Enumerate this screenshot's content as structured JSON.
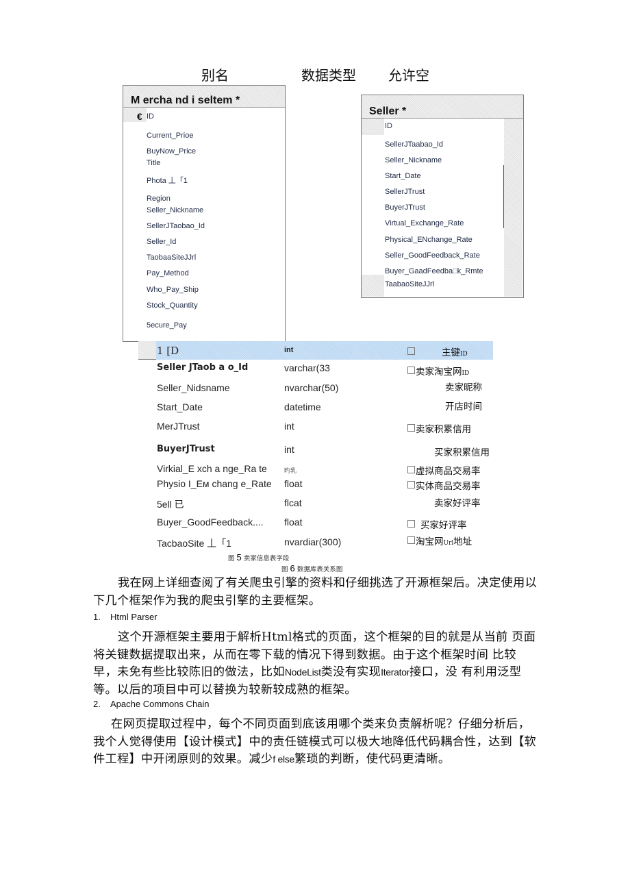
{
  "column_headers": {
    "alias": "别名",
    "data_type": "数据类型",
    "nullable": "允许空"
  },
  "merchandise_entity": {
    "title": "M ercha nd i seltem *",
    "key_icon": "key-icon",
    "key_glyph": "€",
    "fields": [
      "ID",
      "Current_Prioe",
      "BuyNow_Price",
      "Title",
      "Phota 丄「1",
      "Region",
      "Seller_Nickname",
      "SellerJTaobao_Id",
      "Seller_Id",
      "TaobaaSiteJJrl",
      "Pay_Method",
      "Who_Pay_Ship",
      "Stock_Quantity",
      "5ecure_Pay"
    ]
  },
  "seller_entity": {
    "title": "Seller *",
    "fields": [
      "ID",
      "SellerJTaabao_Id",
      "Seller_Nickname",
      "Start_Date",
      "SellerJTrust",
      "BuyerJTrust",
      "Virtual_Exchange_Rate",
      "Physical_ENchange_Rate",
      "Seller_GoodFeedback_Rate",
      "Buyer_GaadFeedba□k_Rmte",
      "TaabaoSiteJJrl"
    ]
  },
  "seller_table": {
    "rows": [
      {
        "alias": "1 [D",
        "type": "int",
        "checkbox": true,
        "desc": "主键",
        "desc_suffix": "ID",
        "selected": true
      },
      {
        "alias": "Seller JTaob a o_Id",
        "type": "varchar(33",
        "checkbox": true,
        "desc": "卖家淘宝网",
        "desc_suffix": "ID",
        "bold": true
      },
      {
        "alias": "Seller_Nidsname",
        "type": "nvarchar(50)",
        "checkbox": false,
        "desc": "卖家昵称",
        "desc_suffix": ""
      },
      {
        "alias": "Start_Date",
        "type": "datetime",
        "checkbox": false,
        "desc": "开店时间",
        "desc_suffix": ""
      },
      {
        "alias": "MerJTrust",
        "type": "int",
        "checkbox": true,
        "desc": "卖家积累信用",
        "desc_suffix": ""
      },
      {
        "alias": "BuyerJTrust",
        "type": "int",
        "checkbox": false,
        "desc": "买家积累信用",
        "desc_suffix": "",
        "bold": true
      },
      {
        "alias": "Virkial_E xch a nge_Ra te",
        "type": "旳乳",
        "checkbox": true,
        "desc": "虚拟商品交易率",
        "desc_suffix": ""
      },
      {
        "alias": "Physio I_Eм chang e_Rate",
        "type": "float",
        "checkbox": true,
        "desc": "实体商品交易率",
        "desc_suffix": ""
      },
      {
        "alias": "5ell 已",
        "type": "flcat",
        "checkbox": false,
        "desc": "卖家好评率",
        "desc_suffix": ""
      },
      {
        "alias": "Buyer_GoodFeedback....",
        "type": "float",
        "checkbox": true,
        "desc": "买家好评率",
        "desc_suffix": ""
      },
      {
        "alias": "TacbaoSite 丄「1",
        "type": "nvardiar(300)",
        "checkbox": true,
        "desc": "淘宝网",
        "desc_suffix": "Url",
        "desc_tail": "地址"
      }
    ]
  },
  "captions": {
    "fig5_prefix": "图",
    "fig5_num": "5",
    "fig5_text": "卖家信息表字段",
    "fig6_prefix": "图",
    "fig6_num": "6",
    "fig6_text": "数据库表关系图"
  },
  "body": {
    "para1": "我在网上详细查阅了有关爬虫引擎的资料和仔细挑选了开源框架后。决定使用以下几个框架作为我的爬虫引擎的主要框架。",
    "item1_num": "1.",
    "item1_label": "Html Parser",
    "para2_a": "这个开源框架主要用于解析Html格式的页面，这个框架的目的就是从当前 页面将关键数据提取出来，从而在零下载的情况下得到数据。由于这个框架时间 比较早，未免有些比较陈旧的做法，比如",
    "para2_b": "NodeList",
    "para2_c": "类没有实现",
    "para2_d": "Iterator",
    "para2_e": "接口，没  有利用泛型等。以后的项目中可以替换为较新较成熟的框架。",
    "item2_num": "2.",
    "item2_label": "Apache Commons Chain",
    "para3_a": "在网页提取过程中，每个不同页面到底该用哪个类来负责解析呢？仔细分析后，我个人觉得使用【设计模式】中的责任链模式可以极大地降低代码耦合性，达到【软件工程】中开闭原则的效果。减少",
    "para3_b": "f else",
    "para3_c": "繁琐的判断，使代码更清晰。"
  }
}
